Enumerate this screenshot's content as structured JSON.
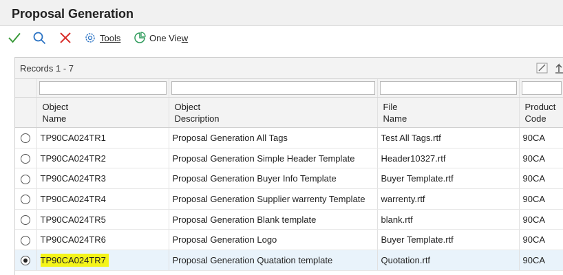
{
  "window": {
    "title": "Proposal Generation"
  },
  "toolbar": {
    "ok_icon": "check-icon",
    "find_icon": "search-icon",
    "cancel_icon": "close-icon",
    "tools_label": "Tools",
    "tools_icon": "gear-icon",
    "oneview_label_main": "One Vie",
    "oneview_label_underlined": "w",
    "oneview_icon": "one-view-icon"
  },
  "grid": {
    "records_label": "Records 1 - 7",
    "header_icons": [
      "edit-grid-icon",
      "export-icon"
    ],
    "filters": [
      "",
      "",
      "",
      ""
    ],
    "columns": [
      {
        "line1": "Object",
        "line2": "Name"
      },
      {
        "line1": "Object",
        "line2": "Description"
      },
      {
        "line1": "File",
        "line2": "Name"
      },
      {
        "line1": "Product",
        "line2": "Code"
      }
    ],
    "rows": [
      {
        "object_name": "TP90CA024TR1",
        "description": "Proposal Generation All Tags",
        "file_name": "Test All Tags.rtf",
        "product_code": "90CA",
        "selected": false
      },
      {
        "object_name": "TP90CA024TR2",
        "description": "Proposal Generation Simple Header Template",
        "file_name": "Header10327.rtf",
        "product_code": "90CA",
        "selected": false
      },
      {
        "object_name": "TP90CA024TR3",
        "description": "Proposal Generation Buyer Info Template",
        "file_name": "Buyer Template.rtf",
        "product_code": "90CA",
        "selected": false
      },
      {
        "object_name": "TP90CA024TR4",
        "description": "Proposal Generation Supplier warrenty Template",
        "file_name": "warrenty.rtf",
        "product_code": "90CA",
        "selected": false
      },
      {
        "object_name": "TP90CA024TR5",
        "description": "Proposal Generation Blank template",
        "file_name": "blank.rtf",
        "product_code": "90CA",
        "selected": false
      },
      {
        "object_name": "TP90CA024TR6",
        "description": "Proposal Generation Logo",
        "file_name": "Buyer Template.rtf",
        "product_code": "90CA",
        "selected": false
      },
      {
        "object_name": "TP90CA024TR7",
        "description": "Proposal Generation Quatation template",
        "file_name": "Quotation.rtf",
        "product_code": "90CA",
        "selected": true
      }
    ]
  },
  "colors": {
    "highlight": "#f4f41a",
    "ok_green": "#3a9a3a",
    "find_blue": "#2b73c4",
    "cancel_red": "#d9302c"
  }
}
